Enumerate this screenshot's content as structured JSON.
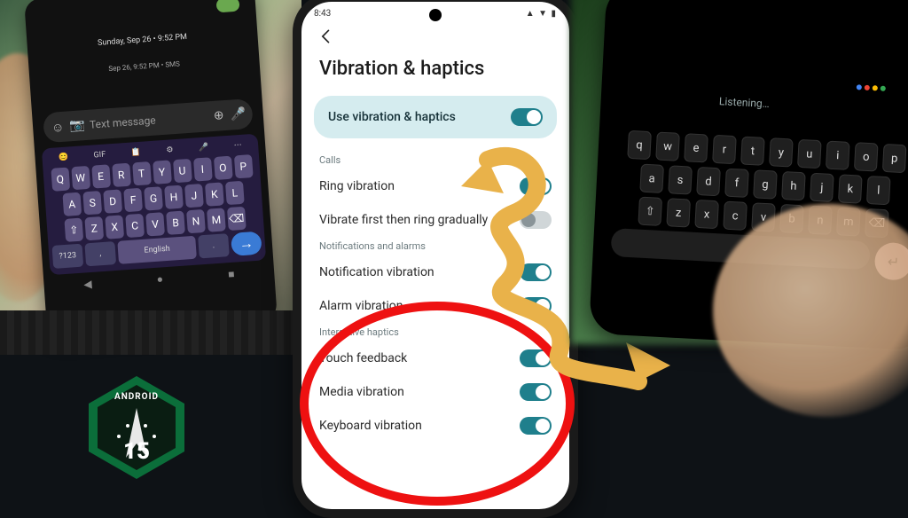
{
  "left_phone": {
    "date_line": "Sunday, Sep 26 • 9:52 PM",
    "timestamp": "Sep 26, 9:52 PM • SMS",
    "input_placeholder": "Text message",
    "kb_toolbar": [
      "😊",
      "GIF",
      "📋",
      "⚙",
      "🎤",
      "⋯"
    ],
    "row1": [
      "Q",
      "W",
      "E",
      "R",
      "T",
      "Y",
      "U",
      "I",
      "O",
      "P"
    ],
    "row2": [
      "A",
      "S",
      "D",
      "F",
      "G",
      "H",
      "J",
      "K",
      "L"
    ],
    "row3": [
      "⇧",
      "Z",
      "X",
      "C",
      "V",
      "B",
      "N",
      "M",
      "⌫"
    ],
    "sym_label": "?123",
    "space_label": "English",
    "enter_label": "→"
  },
  "center": {
    "status_time": "8:43",
    "status_icons": "▲ ▼ ▮",
    "page_title": "Vibration & haptics",
    "master_label": "Use vibration & haptics",
    "sections": [
      {
        "header": "Calls",
        "rows": [
          {
            "label": "Ring vibration",
            "on": true
          },
          {
            "label": "Vibrate first then ring gradually",
            "on": false
          }
        ]
      },
      {
        "header": "Notifications and alarms",
        "rows": [
          {
            "label": "Notification vibration",
            "on": true
          },
          {
            "label": "Alarm vibration",
            "on": true
          }
        ]
      },
      {
        "header": "Interactive haptics",
        "rows": [
          {
            "label": "Touch feedback",
            "on": true
          },
          {
            "label": "Media vibration",
            "on": true
          },
          {
            "label": "Keyboard vibration",
            "on": true
          }
        ]
      }
    ]
  },
  "right_phone": {
    "listening_label": "Listening…",
    "row1": [
      "q",
      "w",
      "e",
      "r",
      "t",
      "y",
      "u",
      "i",
      "o",
      "p"
    ],
    "row2": [
      "a",
      "s",
      "d",
      "f",
      "g",
      "h",
      "j",
      "k",
      "l"
    ],
    "row3": [
      "⇧",
      "z",
      "x",
      "c",
      "v",
      "b",
      "n",
      "m",
      "⌫"
    ],
    "enter_label": "↵"
  },
  "badge": {
    "top_text": "ANDROID",
    "number": "15"
  },
  "colors": {
    "toggle_on": "#1f7f8c",
    "master_bg": "#d5ecef",
    "circle": "#e11",
    "arrow": "#e9b24a",
    "badge_green": "#0b6e3a",
    "badge_dark": "#0a1d12"
  }
}
